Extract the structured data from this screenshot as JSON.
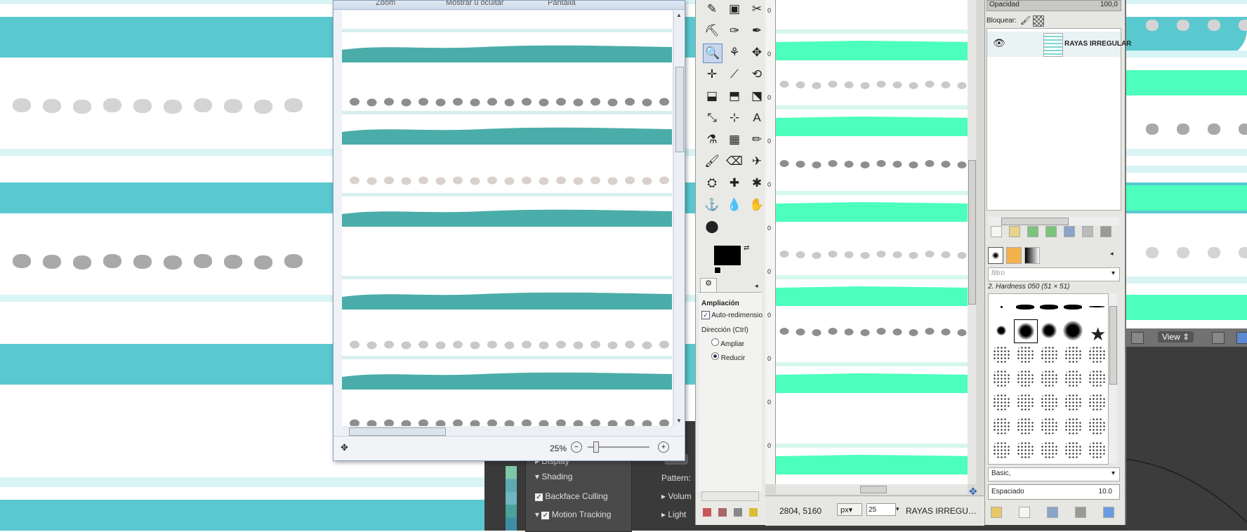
{
  "colors": {
    "teal_stripe": "#5ac8cf",
    "light_teal": "#d9f4f4",
    "grey_dot": "#d4d4d4",
    "dark_grey_dot": "#a9a9a9",
    "viewer_teal": "#4aada9",
    "mint": "#4cffbc",
    "blender_bg": "#3a3a3a"
  },
  "viewer": {
    "ribbon": {
      "zoom": "Zoom",
      "show_hide": "Mostrar u ocultar",
      "screen": "Pantalla"
    },
    "zoom_percent": "25%"
  },
  "blender": {
    "panel_items": [
      {
        "label": "Display",
        "expanded": false
      },
      {
        "label": "Shading",
        "expanded": true
      },
      {
        "label": "Backface Culling",
        "checked": true
      },
      {
        "label": "Motion Tracking",
        "checked": true,
        "expanded": true
      }
    ],
    "pattern_label": "Pattern:",
    "volume_label": "Volum",
    "light_label": "Light",
    "view_menu": "View"
  },
  "toolbox": {
    "tool_options_title": "Ampliación",
    "auto_resize_label": "Auto-redimensio",
    "auto_resize_checked": true,
    "direction_label": "Dirección (Ctrl)",
    "direction_options": [
      "Ampliar",
      "Reducir"
    ],
    "direction_selected": "Reducir"
  },
  "image_window": {
    "coords": "2804, 5160",
    "unit": "px",
    "zoom": "25",
    "layer_name": "RAYAS IRREGU…",
    "ruler_marks": [
      "0",
      "0",
      "0",
      "0",
      "0",
      "0",
      "0",
      "0",
      "0",
      "0",
      "0"
    ]
  },
  "layers": {
    "opacity_label": "Opacidad",
    "opacity_value": "100,0",
    "lock_label": "Bloquear:",
    "layer_name": "RAYAS IRREGULAR"
  },
  "brushes": {
    "filter_placeholder": "filtro",
    "selected_brush": "2. Hardness 050 (51 × 51)",
    "preset": "Basic,",
    "spacing_label": "Espaciado",
    "spacing_value": "10.0"
  }
}
